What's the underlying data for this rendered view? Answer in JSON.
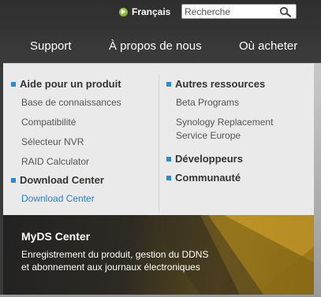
{
  "header": {
    "language": "Français",
    "search_placeholder": "Recherche"
  },
  "nav": {
    "items": [
      "Support",
      "À propos de nous",
      "Où acheter"
    ]
  },
  "dropdown": {
    "left": {
      "section1_title": "Aide pour un produit",
      "section1_links": [
        "Base de connaissances",
        "Compatibilité",
        "Sélecteur NVR",
        "RAID Calculator"
      ],
      "section2_title": "Download Center",
      "section2_links": [
        "Download Center"
      ]
    },
    "right": {
      "section1_title": "Autres ressources",
      "section1_links": [
        "Beta Programs",
        "Synology Replacement",
        "Service Europe"
      ],
      "section2_title": "Développeurs",
      "section3_title": "Communauté"
    }
  },
  "banner": {
    "title": "MyDS Center",
    "text_line1": "Enregistrement du produit, gestion du DDNS",
    "text_line2": "et abonnement aux journaux électroniques"
  },
  "colors": {
    "accent": "#2b8ad6",
    "active_link": "#2a7fc9",
    "lang_icon": "#8cc43a"
  }
}
